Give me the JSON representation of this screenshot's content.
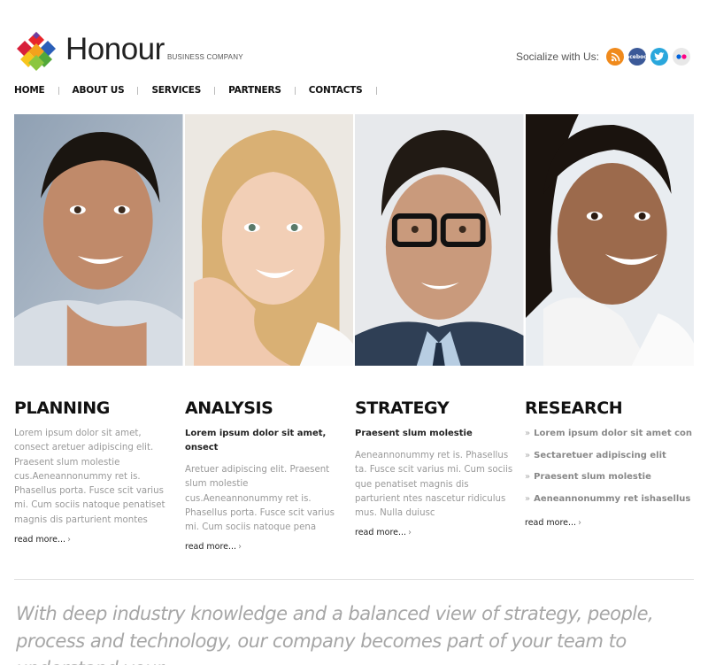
{
  "header": {
    "logo_text": "Honour",
    "logo_sub": "BUSINESS COMPANY",
    "social_label": "Socialize with Us:",
    "social_icons": [
      "rss-icon",
      "facebook-icon",
      "twitter-icon",
      "flickr-icon"
    ],
    "facebook_text": "facebook"
  },
  "nav": [
    "HOME",
    "ABOUT US",
    "SERVICES",
    "PARTNERS",
    "CONTACTS"
  ],
  "columns": [
    {
      "title": "PLANNING",
      "body": "Lorem ipsum dolor sit amet, consect aretuer adipiscing elit. Praesent slum molestie cus.Aeneannonummy ret is. Phasellus porta. Fusce scit varius mi. Cum sociis natoque penatiset magnis dis parturient montes",
      "more": "read more...",
      "arrow": "›"
    },
    {
      "title": "ANALYSIS",
      "lead": "Lorem ipsum dolor sit amet, onsect",
      "body": "Aretuer adipiscing elit. Praesent slum molestie cus.Aeneannonummy ret is. Phasellus porta. Fusce scit varius mi. Cum sociis natoque pena",
      "more": "read more...",
      "arrow": "›"
    },
    {
      "title": "STRATEGY",
      "lead": "Praesent slum molestie",
      "body": "Aeneannonummy ret is. Phasellus ta. Fusce scit varius mi. Cum sociis que penatiset magnis dis parturient ntes nascetur ridiculus mus. Nulla duiusc",
      "more": "read more...",
      "arrow": "›"
    },
    {
      "title": "RESEARCH",
      "items": [
        "Lorem ipsum dolor sit amet con",
        "Sectaretuer adipiscing elit",
        "Praesent slum molestie",
        "Aeneannonummy ret ishasellus"
      ],
      "bullet": "»",
      "more": "read more...",
      "arrow": "›"
    }
  ],
  "quote": "With deep industry knowledge and a balanced view of strategy, people, process and technology, our company becomes part of your team to understand your",
  "colors": {
    "accent_orange": "#f08a1c",
    "facebook_blue": "#3b5998",
    "twitter_blue": "#2aa7dc",
    "quote_gray": "#a6a6a6"
  }
}
